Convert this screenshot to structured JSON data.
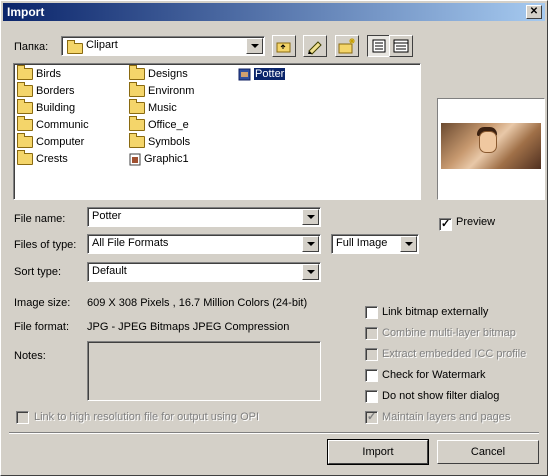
{
  "window": {
    "title": "Import",
    "close_glyph": "✕"
  },
  "folder_row": {
    "label": "Папка:",
    "current_folder": "Clipart"
  },
  "file_list": {
    "col1": [
      "Birds",
      "Borders",
      "Building",
      "Communic",
      "Computer",
      "Crests"
    ],
    "col2": [
      "Designs",
      "Environm",
      "Music",
      "Office_e",
      "Symbols"
    ],
    "col2_file": "Graphic1",
    "col3_file": "Potter"
  },
  "form": {
    "file_name_label": "File name:",
    "file_name_value": "Potter",
    "files_of_type_label": "Files of type:",
    "files_of_type_value": "All File Formats",
    "image_mode_value": "Full Image",
    "sort_type_label": "Sort type:",
    "sort_type_value": "Default",
    "preview_label": "Preview",
    "image_size_label": "Image size:",
    "image_size_value": "609 X 308 Pixels , 16.7 Million Colors (24-bit)",
    "file_format_label": "File format:",
    "file_format_value": "JPG - JPEG Bitmaps JPEG Compression",
    "notes_label": "Notes:"
  },
  "options": {
    "link_bitmap": "Link bitmap externally",
    "combine_multilayer": "Combine multi-layer bitmap",
    "extract_icc": "Extract embedded ICC profile",
    "check_watermark": "Check for Watermark",
    "no_filter_dialog": "Do not show filter dialog",
    "maintain_layers": "Maintain layers and pages",
    "link_high_res": "Link to high resolution file for output using OPI"
  },
  "buttons": {
    "import": "Import",
    "cancel": "Cancel"
  },
  "colors": {
    "title_bar": "#0a246a",
    "face": "#d4d0c8",
    "selection": "#0a246a"
  }
}
